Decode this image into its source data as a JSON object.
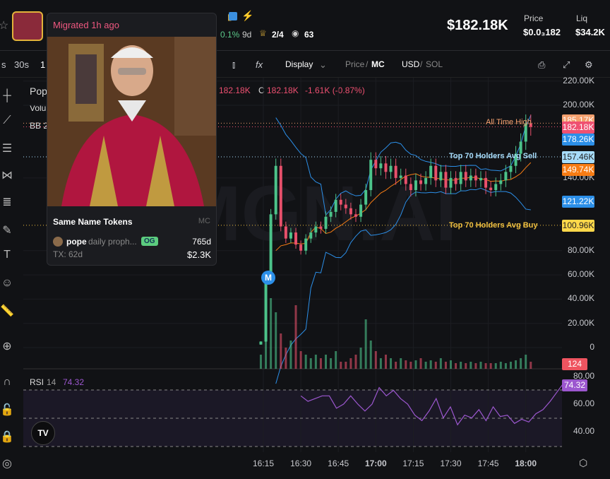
{
  "header": {
    "market_cap": "$182.18K",
    "price_label": "Price",
    "price_value": "$0.0₃182",
    "liq_label": "Liq",
    "liq_value": "$34.2K",
    "stat_pct": "0.1%",
    "stat_age": "9d",
    "holders_ratio": "2/4",
    "watchers": "63"
  },
  "toolbar": {
    "intervals": [
      "s",
      "30s",
      "1"
    ],
    "display": "Display",
    "price": "Price",
    "mc": "MC",
    "usd": "USD",
    "sol": "SOL",
    "fx": "fx"
  },
  "legend": {
    "name": "Pop",
    "volume": "Volu",
    "bb": "BB 2",
    "ohlc": "182.18K",
    "c_label": "C",
    "close": "182.18K",
    "change": "-1.61K (-0.87%)"
  },
  "popup": {
    "migrated": "Migrated 1h ago",
    "section": "Same Name Tokens",
    "mc_label": "MC",
    "token_name": "pope",
    "token_desc": "daily proph...",
    "badge": "OG",
    "age": "765d",
    "tx": "TX: 62d",
    "mc_value": "$2.3K"
  },
  "annotations": {
    "ath": "All Time High",
    "avg_sell": "Top 70 Holders Avg Sell",
    "avg_buy": "Top 70 Holders Avg Buy",
    "marker": "M"
  },
  "price_tags": [
    {
      "label": "185.17K",
      "color": "#f4a06e"
    },
    {
      "label": "182.18K",
      "color": "#ef5071"
    },
    {
      "label": "178.26K",
      "color": "#2c8fe8"
    },
    {
      "label": "157.46K",
      "color": "#a7dcfb",
      "text": "#222"
    },
    {
      "label": "149.74K",
      "color": "#f77c14"
    },
    {
      "label": "121.22K",
      "color": "#2c8fe8"
    },
    {
      "label": "100.96K",
      "color": "#ffd84a",
      "text": "#222"
    },
    {
      "label": "124",
      "color": "#ef5460"
    },
    {
      "label": "74.32",
      "color": "#9c57cf"
    }
  ],
  "rsi": {
    "label": "RSI",
    "period": "14",
    "value": "74.32"
  },
  "chart_data": {
    "type": "candlestick",
    "y_ticks": [
      "220.00K",
      "200.00K",
      "140.00K",
      "80.00K",
      "60.00K",
      "40.00K",
      "20.00K",
      "0"
    ],
    "y_tick_values": [
      220,
      200,
      140,
      80,
      60,
      40,
      20,
      0
    ],
    "rsi_ticks": [
      "80.00",
      "60.00",
      "40.00"
    ],
    "x_ticks": [
      "16:15",
      "16:30",
      "16:45",
      "17:00",
      "17:15",
      "17:30",
      "17:45",
      "18:00"
    ],
    "interval_minutes": 2,
    "start_minute": -1,
    "closes": [
      5,
      55,
      110,
      150,
      100,
      90,
      95,
      85,
      80,
      90,
      95,
      100,
      98,
      108,
      112,
      122,
      118,
      115,
      110,
      108,
      118,
      130,
      155,
      148,
      152,
      145,
      150,
      140,
      142,
      135,
      130,
      138,
      135,
      140,
      150,
      138,
      145,
      132,
      140,
      135,
      145,
      138,
      142,
      138,
      140,
      132,
      130,
      135,
      138,
      145,
      150,
      160,
      170,
      185,
      182.18
    ],
    "volumes": [
      20,
      60,
      100,
      80,
      50,
      30,
      40,
      90,
      25,
      20,
      15,
      20,
      15,
      20,
      15,
      25,
      10,
      10,
      15,
      20,
      30,
      70,
      40,
      25,
      15,
      20,
      15,
      10,
      15,
      12,
      10,
      12,
      15,
      10,
      12,
      10,
      15,
      10,
      12,
      8,
      10,
      8,
      10,
      8,
      10,
      8,
      8,
      8,
      10,
      8,
      10,
      12,
      15,
      20,
      10
    ],
    "rsi_values": [
      66,
      62,
      64,
      66,
      66,
      57,
      60,
      66,
      60,
      55,
      60,
      72,
      66,
      70,
      64,
      60,
      52,
      48,
      55,
      64,
      50,
      58,
      45,
      52,
      50,
      56,
      48,
      58,
      51,
      52,
      46,
      49,
      47,
      53,
      56,
      62,
      69,
      76,
      74.32
    ],
    "levels": {
      "ath": 185.17,
      "avg_sell": 157.46,
      "avg_buy": 100.96
    }
  }
}
